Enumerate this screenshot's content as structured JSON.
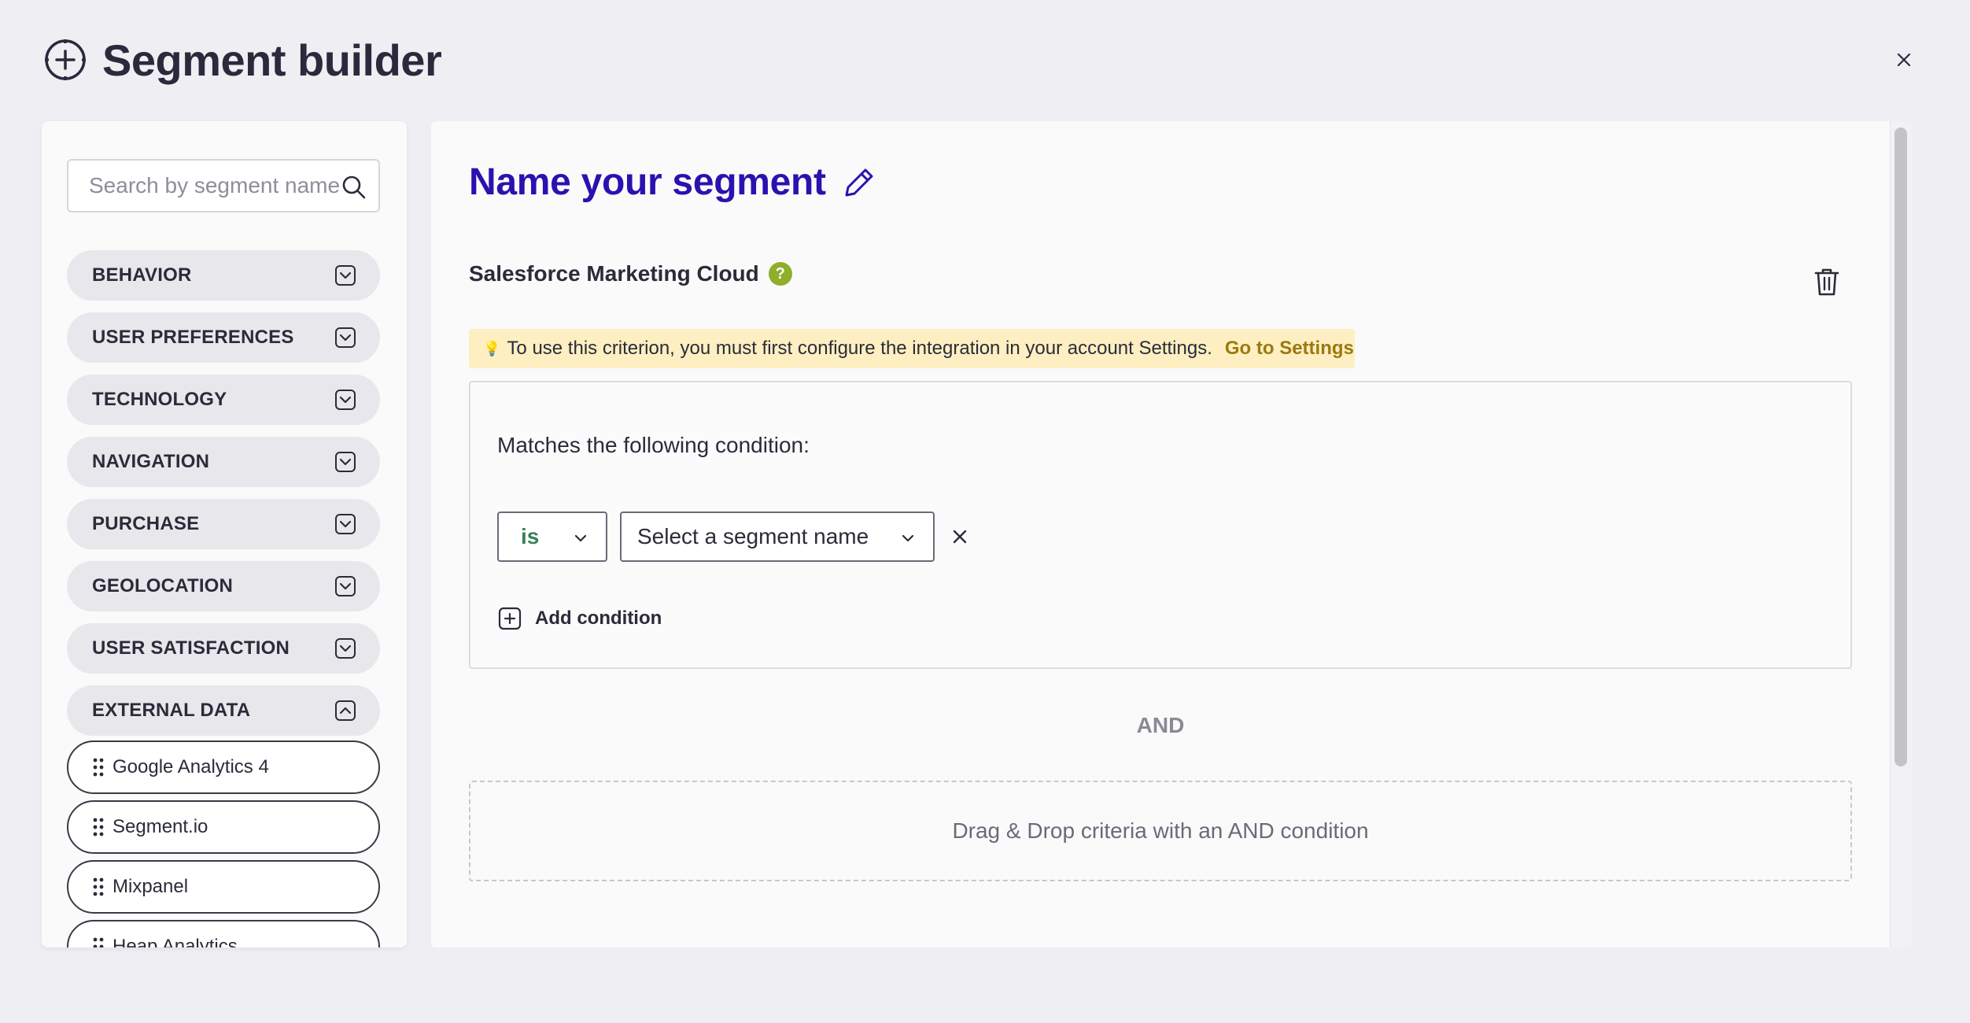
{
  "header": {
    "title": "Segment builder",
    "icon": "crosshair-plus-icon",
    "close_icon": "close-icon"
  },
  "sidebar": {
    "search": {
      "placeholder": "Search by segment name",
      "value": ""
    },
    "categories": [
      {
        "label": "BEHAVIOR",
        "expanded": false
      },
      {
        "label": "USER PREFERENCES",
        "expanded": false
      },
      {
        "label": "TECHNOLOGY",
        "expanded": false
      },
      {
        "label": "NAVIGATION",
        "expanded": false
      },
      {
        "label": "PURCHASE",
        "expanded": false
      },
      {
        "label": "GEOLOCATION",
        "expanded": false
      },
      {
        "label": "USER SATISFACTION",
        "expanded": false
      },
      {
        "label": "EXTERNAL DATA",
        "expanded": true
      }
    ],
    "external_items": [
      {
        "label": "Google Analytics 4"
      },
      {
        "label": "Segment.io"
      },
      {
        "label": "Mixpanel"
      },
      {
        "label": "Heap Analytics"
      }
    ]
  },
  "main": {
    "segment_name": "Name your segment",
    "criterion": {
      "title": "Salesforce Marketing Cloud",
      "help_glyph": "?",
      "warning": {
        "text": "To use this criterion, you must first configure the integration in your account Settings.",
        "link": "Go to Settings"
      },
      "condition_label": "Matches the following condition:",
      "operator": "is",
      "segment_select": "Select a segment name",
      "add_condition": "Add condition"
    },
    "and_label": "AND",
    "dropzone": "Drag & Drop criteria with an AND condition"
  },
  "colors": {
    "accent": "#2a12b0",
    "help_badge": "#8fae2a",
    "warning_bg": "#fdefc1",
    "warning_link": "#9a7a10",
    "operator_text": "#3b7f5a"
  }
}
